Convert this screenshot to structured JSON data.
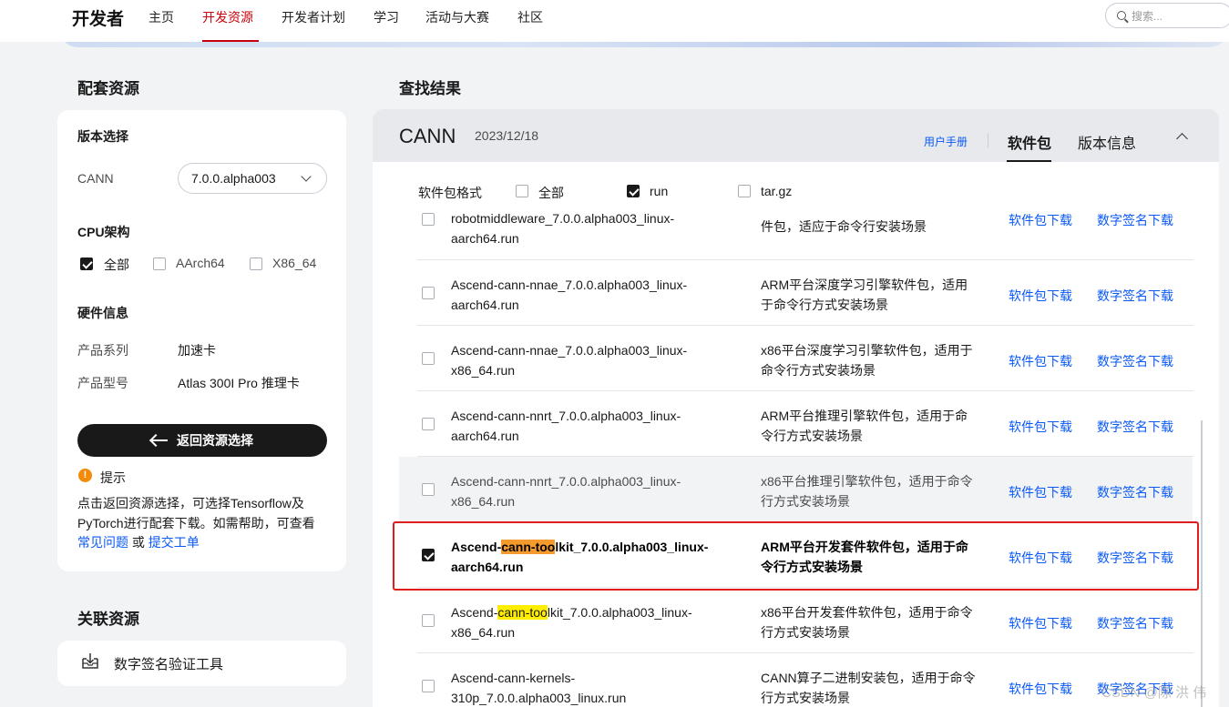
{
  "nav": {
    "logo": "开发者",
    "items": [
      "主页",
      "开发资源",
      "开发者计划",
      "学习",
      "活动与大赛",
      "社区"
    ],
    "active": "开发资源",
    "search_placeholder": "搜索..."
  },
  "sidebar": {
    "title": "配套资源",
    "version_label": "版本选择",
    "cann_label": "CANN",
    "cann_version": "7.0.0.alpha003",
    "cpu_label": "CPU架构",
    "cpu_options": [
      {
        "label": "全部",
        "checked": true
      },
      {
        "label": "AArch64",
        "checked": false
      },
      {
        "label": "X86_64",
        "checked": false
      }
    ],
    "hw_label": "硬件信息",
    "series_label": "产品系列",
    "series_value": "加速卡",
    "model_label": "产品型号",
    "model_value": "Atlas 300I Pro 推理卡",
    "back_button": "返回资源选择",
    "tip_title": "提示",
    "tip_text": "点击返回资源选择，可选择Tensorflow及PyTorch进行配套下载。如需帮助，可查看",
    "tip_link1": "常见问题",
    "tip_or": "或",
    "tip_link2": "提交工单",
    "related_title": "关联资源",
    "related_item": "数字签名验证工具"
  },
  "results": {
    "title": "查找结果",
    "product": "CANN",
    "date": "2023/12/18",
    "manual_link": "用户手册",
    "tabs": [
      "软件包",
      "版本信息"
    ],
    "active_tab": "软件包",
    "format_label": "软件包格式",
    "formats": [
      {
        "label": "全部",
        "checked": false
      },
      {
        "label": "run",
        "checked": true
      },
      {
        "label": "tar.gz",
        "checked": false
      }
    ],
    "download_label": "软件包下载",
    "signature_label": "数字签名下载",
    "rows": [
      {
        "name": "robotmiddleware_7.0.0.alpha003_linux-aarch64.run",
        "desc": "件包，适应于命令行安装场景",
        "checked": false
      },
      {
        "name": "Ascend-cann-nnae_7.0.0.alpha003_linux-aarch64.run",
        "desc": "ARM平台深度学习引擎软件包，适用于命令行方式安装场景",
        "checked": false
      },
      {
        "name": "Ascend-cann-nnae_7.0.0.alpha003_linux-x86_64.run",
        "desc": "x86平台深度学习引擎软件包，适用于命令行方式安装场景",
        "checked": false
      },
      {
        "name": "Ascend-cann-nnrt_7.0.0.alpha003_linux-aarch64.run",
        "desc": "ARM平台推理引擎软件包，适用于命令行方式安装场景",
        "checked": false
      },
      {
        "name": "Ascend-cann-nnrt_7.0.0.alpha003_linux-x86_64.run",
        "desc": "x86平台推理引擎软件包，适用于命令行方式安装场景",
        "checked": false
      },
      {
        "name_pre": "Ascend-",
        "name_hl": "cann-too",
        "name_post": "lkit_7.0.0.alpha003_linux-aarch64.run",
        "desc": "ARM平台开发套件软件包，适用于命令行方式安装场景",
        "checked": true
      },
      {
        "name_pre": "Ascend-",
        "name_hl": "cann-too",
        "name_post": "lkit_7.0.0.alpha003_linux-x86_64.run",
        "desc": "x86平台开发套件软件包，适用于命令行方式安装场景",
        "checked": false
      },
      {
        "name": "Ascend-cann-kernels-310p_7.0.0.alpha003_linux.run",
        "desc": "CANN算子二进制安装包，适用于命令行方式安装场景",
        "checked": false
      }
    ]
  },
  "watermark": "CSDN @陈 洪 伟"
}
